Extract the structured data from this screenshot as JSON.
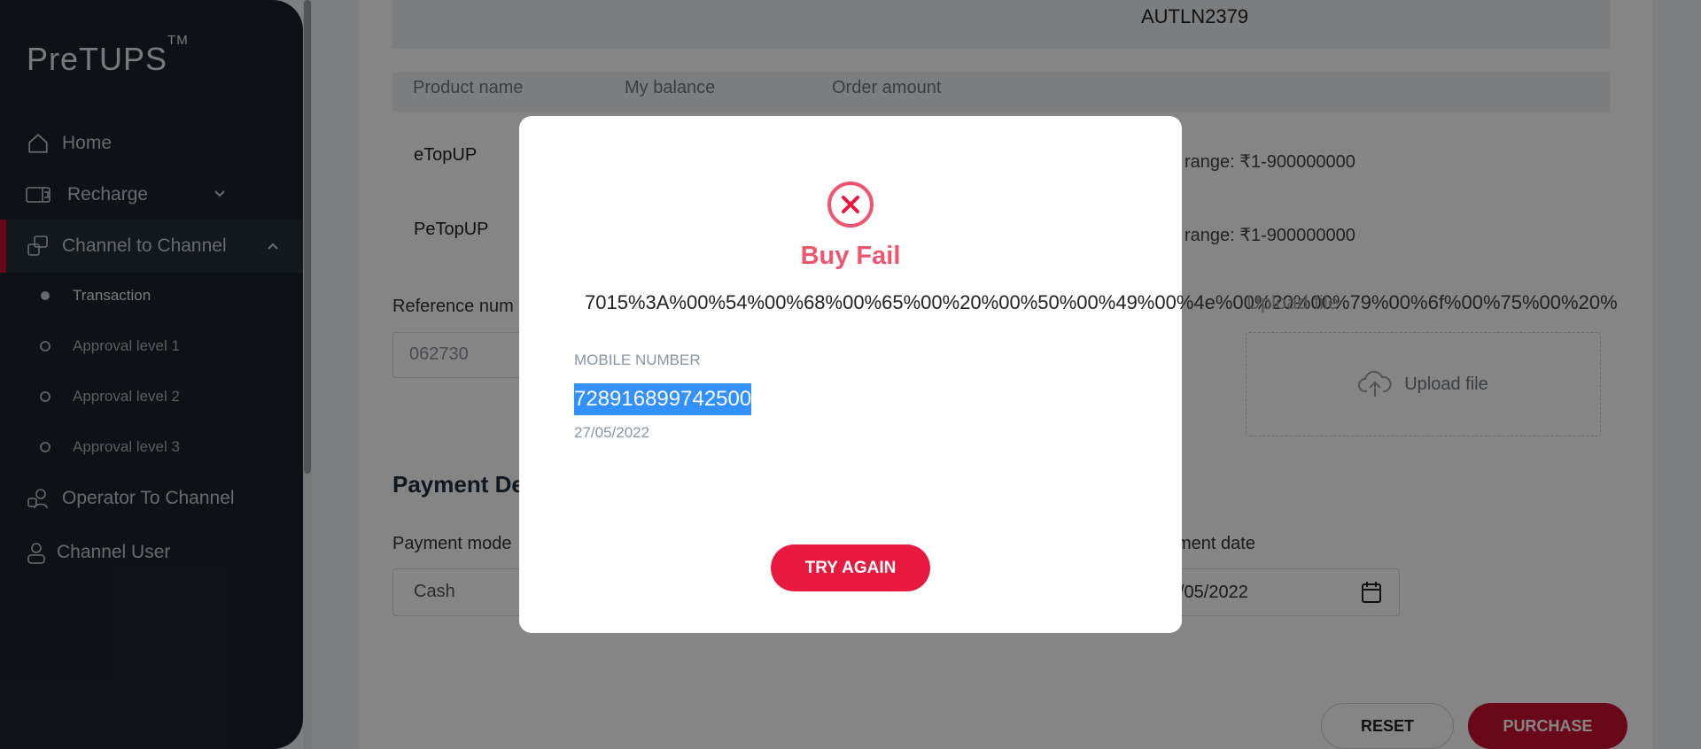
{
  "brand": {
    "name": "PreTUPS",
    "tm": "TM"
  },
  "sidebar": {
    "items": [
      {
        "label": "Home",
        "icon": "home-icon"
      },
      {
        "label": "Recharge",
        "icon": "recharge-icon"
      },
      {
        "label": "Channel to Channel",
        "icon": "channel-transfer-icon"
      },
      {
        "label": "Operator To Channel",
        "icon": "operator-icon"
      },
      {
        "label": "Channel User",
        "icon": "user-icon"
      }
    ],
    "subitems": [
      {
        "label": "Transaction"
      },
      {
        "label": "Approval level 1"
      },
      {
        "label": "Approval level 2"
      },
      {
        "label": "Approval level 3"
      }
    ]
  },
  "main": {
    "auth_code": "AUTLN2379",
    "table_headers": [
      "Product name",
      "My balance",
      "Order amount"
    ],
    "products": [
      {
        "name": "eTopUP",
        "range": "range: ₹1-900000000"
      },
      {
        "name": "PeTopUP",
        "range": "range: ₹1-900000000"
      }
    ],
    "reference_label": "Reference num",
    "reference_value": "062730",
    "upload_label": "Upload file",
    "payment_section": "Payment De",
    "payment_mode_label": "Payment mode",
    "payment_mode_value": "Cash",
    "payment_date_label": "ment date",
    "payment_date_value": "/05/2022",
    "reset_label": "RESET",
    "purchase_label": "PURCHASE"
  },
  "modal": {
    "title": "Buy Fail",
    "message": "7015%3A%00%54%00%68%00%65%00%20%00%50%00%49%00%4e%00%20%00%79%00%6f%00%75%00%20%",
    "overlap_text": "Upload file",
    "mobile_label": "MOBILE NUMBER",
    "mobile_number": "728916899742500",
    "date": "27/05/2022",
    "button": "TRY AGAIN"
  },
  "colors": {
    "accent": "#c8102e",
    "error": "#f0556f",
    "button": "#e8183e",
    "sidebar": "#1c232c",
    "selection": "#3390ff"
  }
}
